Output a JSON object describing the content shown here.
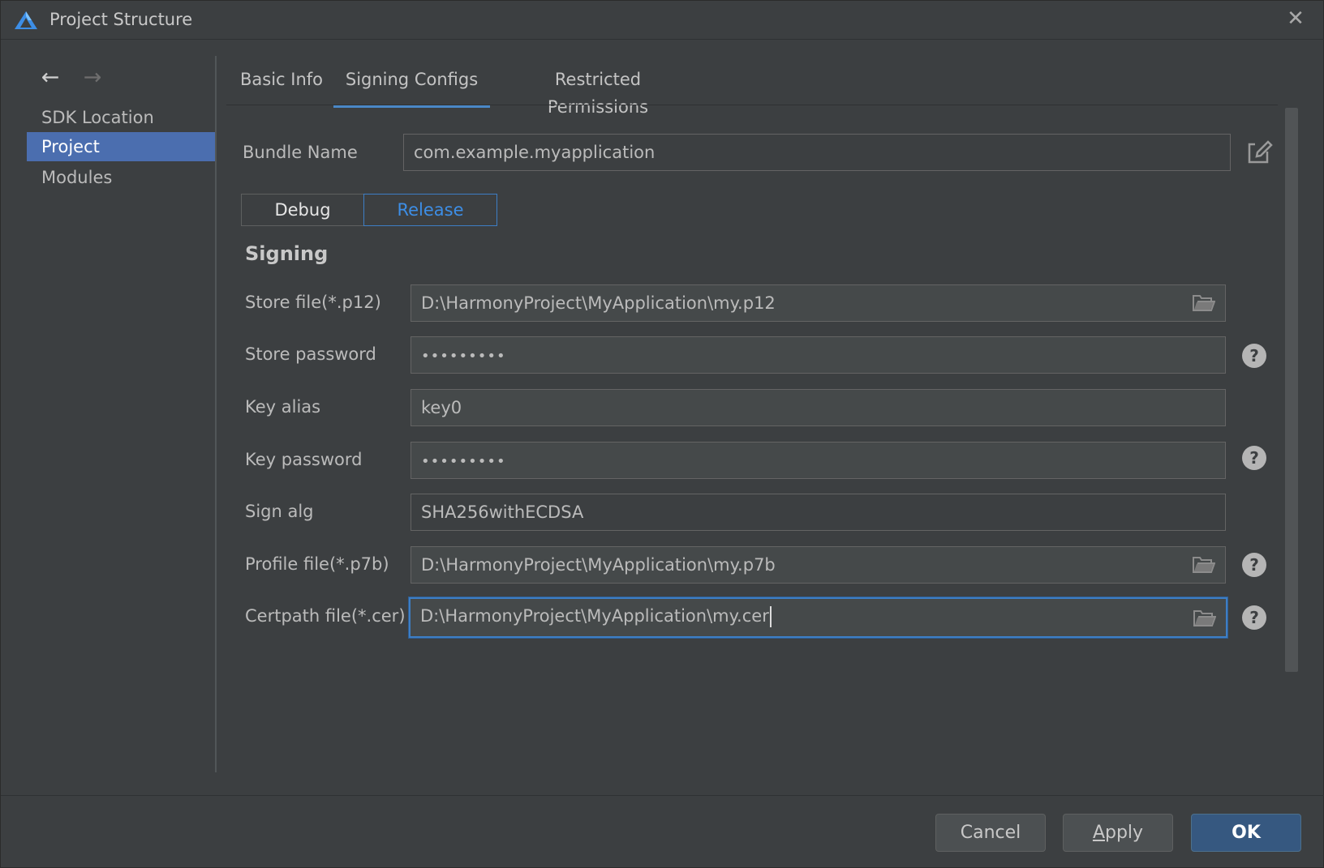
{
  "window": {
    "title": "Project Structure",
    "close_glyph": "✕"
  },
  "nav": {
    "back_glyph": "←",
    "forward_glyph": "→"
  },
  "sidebar": {
    "items": [
      {
        "label": "SDK Location",
        "selected": false
      },
      {
        "label": "Project",
        "selected": true
      },
      {
        "label": "Modules",
        "selected": false
      }
    ]
  },
  "tabs": [
    {
      "label": "Basic Info",
      "active": false
    },
    {
      "label": "Signing Configs",
      "active": true
    },
    {
      "label": "Restricted Permissions",
      "active": false
    }
  ],
  "bundle": {
    "label": "Bundle Name",
    "value": "com.example.myapplication"
  },
  "build_type": {
    "debug": "Debug",
    "release": "Release",
    "selected": "Release"
  },
  "signing": {
    "section_title": "Signing",
    "store_file": {
      "label": "Store file(*.p12)",
      "value": "D:\\HarmonyProject\\MyApplication\\my.p12"
    },
    "store_password": {
      "label": "Store password",
      "value": "•••••••••"
    },
    "key_alias": {
      "label": "Key alias",
      "value": "key0"
    },
    "key_password": {
      "label": "Key password",
      "value": "•••••••••"
    },
    "sign_alg": {
      "label": "Sign alg",
      "value": "SHA256withECDSA"
    },
    "profile_file": {
      "label": "Profile file(*.p7b)",
      "value": "D:\\HarmonyProject\\MyApplication\\my.p7b"
    },
    "certpath_file": {
      "label": "Certpath file(*.cer)",
      "value": "D:\\HarmonyProject\\MyApplication\\my.cer"
    }
  },
  "help_glyph": "?",
  "footer": {
    "cancel": "Cancel",
    "apply": "Apply",
    "ok": "OK"
  },
  "colors": {
    "background": "#3c3f41",
    "selection": "#4b6eaf",
    "accent": "#3d7ec5",
    "primary_button": "#365880"
  },
  "icons": {
    "app_logo": "harmony-triangle-logo",
    "edit": "edit-pencil-icon",
    "folder": "folder-open-icon",
    "help": "question-circle-icon"
  }
}
